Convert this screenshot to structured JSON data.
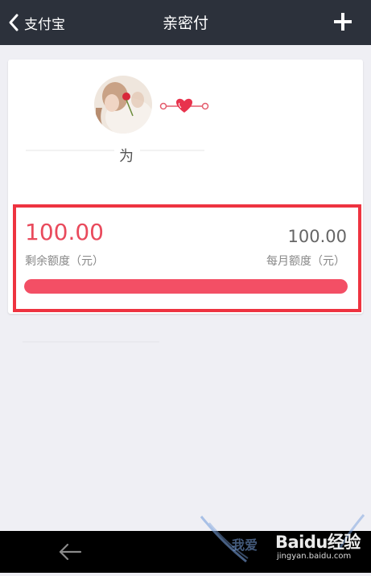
{
  "header": {
    "back_label": "支付宝",
    "title": "亲密付"
  },
  "card": {
    "for_text": "为"
  },
  "quota": {
    "remaining_amount": "100.00",
    "remaining_label": "剩余额度（元）",
    "monthly_amount": "100.00",
    "monthly_label": "每月额度（元）",
    "progress_fraction": 1.0
  },
  "watermark": {
    "brand": "Baidu",
    "brand_suffix": "经验",
    "cn_text": "我爱",
    "url": "jingyan.baidu.com"
  },
  "colors": {
    "header_bg": "#2c313b",
    "accent": "#e94a5c",
    "progress": "#f34f65",
    "highlight": "#ee3340"
  },
  "icons": {
    "back": "chevron-left-icon",
    "add": "plus-icon",
    "link": "heart-link-icon",
    "nav_back": "arrow-left-icon"
  }
}
